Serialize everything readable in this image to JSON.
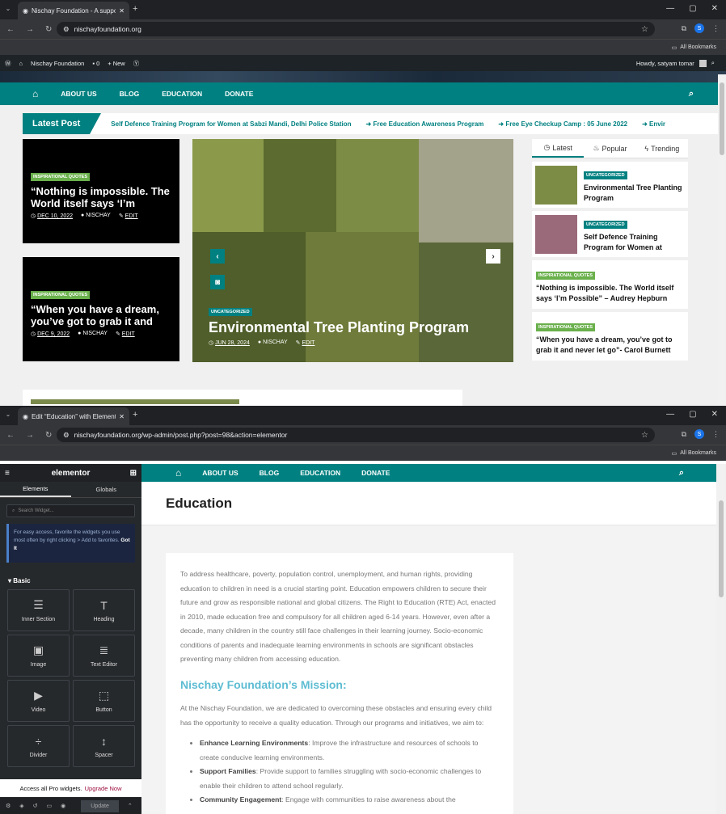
{
  "w1": {
    "tab_title": "Nischay Foundation - A suppor",
    "url": "nischayfoundation.org",
    "bookmarks": "All Bookmarks",
    "wp_bar": {
      "site": "Nischay Foundation",
      "comments": "0",
      "new": "New",
      "howdy": "Howdy, satyam tomar"
    },
    "menu": [
      "ABOUT US",
      "BLOG",
      "EDUCATION",
      "DONATE"
    ],
    "latest_label": "Latest Post",
    "ticker": [
      "Self Defence Training Program for Women at Sabzi Mandi, Delhi Police Station",
      "Free Education Awareness Program",
      "Free Eye Checkup Camp : 05 June 2022",
      "Envir"
    ],
    "cards": [
      {
        "badge": "INSPIRATIONAL QUOTES",
        "title": "“Nothing is impossible. The World itself says ‘I’m Possible” – Audrey Hepburn",
        "date": "DEC 10, 2022",
        "author": "NISCHAY",
        "edit": "EDIT"
      },
      {
        "badge": "INSPIRATIONAL QUOTES",
        "title": "“When you have a dream, you’ve got to grab it and never let go”- Carol Burnett",
        "date": "DEC 9, 2022",
        "author": "NISCHAY",
        "edit": "EDIT"
      }
    ],
    "slider": {
      "badge": "UNCATEGORIZED",
      "title": "Environmental Tree Planting Program",
      "date": "JUN 28, 2024",
      "author": "NISCHAY",
      "edit": "EDIT"
    },
    "side_tabs": [
      "Latest",
      "Popular",
      "Trending"
    ],
    "side_items": [
      {
        "badge": "UNCATEGORIZED",
        "title": "Environmental Tree Planting Program"
      },
      {
        "badge": "UNCATEGORIZED",
        "title": "Self Defence Training Program for Women at"
      },
      {
        "badge": "INSPIRATIONAL QUOTES",
        "title": "“Nothing is impossible. The World itself says ‘I’m Possible” – Audrey Hepburn"
      },
      {
        "badge": "INSPIRATIONAL QUOTES",
        "title": "“When you have a dream, you’ve got to grab it and never let go”- Carol Burnett"
      }
    ]
  },
  "w2": {
    "tab_title": "Edit “Education” with Elemento",
    "url": "nischayfoundation.org/wp-admin/post.php?post=98&action=elementor",
    "bookmarks": "All Bookmarks",
    "panel": {
      "logo": "elementor",
      "tabs": [
        "Elements",
        "Globals"
      ],
      "search_placeholder": "Search Widget...",
      "tip": "For easy access, favorite the widgets you use most often by right clicking > Add to favorites.",
      "tip_link": "Got It",
      "section": "Basic",
      "widgets": [
        "Inner Section",
        "Heading",
        "Image",
        "Text Editor",
        "Video",
        "Button",
        "Divider",
        "Spacer"
      ],
      "pro_text": "Access all Pro widgets.",
      "pro_link": "Upgrade Now",
      "update": "Update"
    },
    "menu": [
      "ABOUT US",
      "BLOG",
      "EDUCATION",
      "DONATE"
    ],
    "page_title": "Education",
    "intro": "To address healthcare, poverty, population control, unemployment, and human rights, providing education to children in need is a crucial starting point. Education empowers children to secure their future and grow as responsible national and global citizens. The Right to Education (RTE) Act, enacted in 2010, made education free and compulsory for all children aged 6-14 years. However, even after a decade, many children in the country still face challenges in their learning journey. Socio-economic conditions of parents and inadequate learning environments in schools are significant obstacles preventing many children from accessing education.",
    "mission_heading": "Nischay Foundation’s Mission:",
    "mission_text": "At the Nischay Foundation, we are dedicated to overcoming these obstacles and ensuring every child has the opportunity to receive a quality education. Through our programs and initiatives, we aim to:",
    "bullets": [
      {
        "b": "Enhance Learning Environments",
        "t": ": Improve the infrastructure and resources of schools to create conducive learning environments."
      },
      {
        "b": "Support Families",
        "t": ": Provide support to families struggling with socio-economic challenges to enable their children to attend school regularly."
      },
      {
        "b": "Community Engagement",
        "t": ": Engage with communities to raise awareness about the"
      }
    ]
  }
}
